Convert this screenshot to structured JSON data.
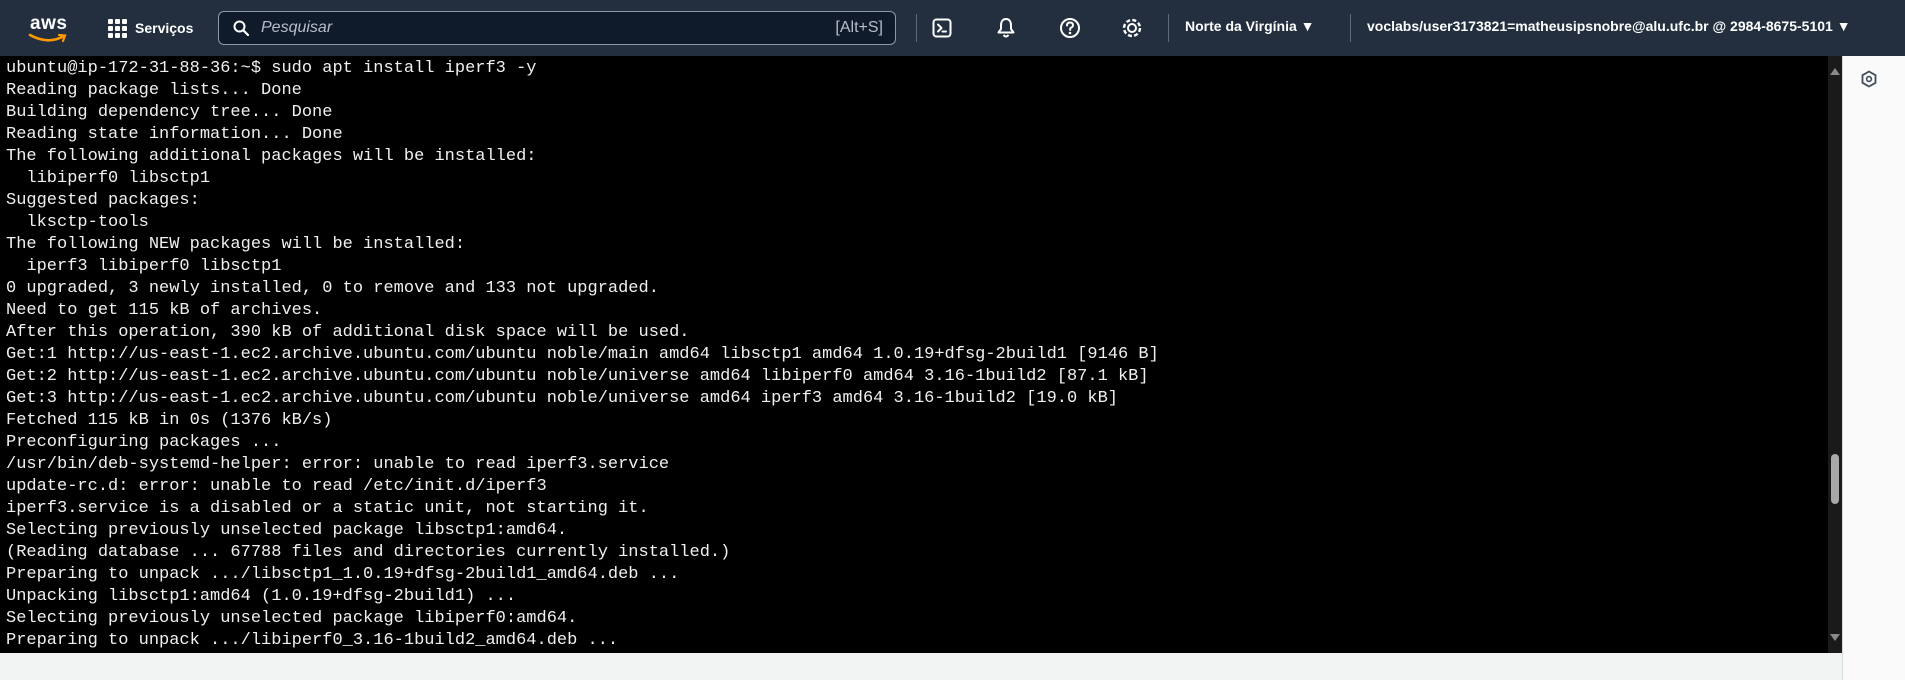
{
  "nav": {
    "logo_text": "aws",
    "services_label": "Serviços",
    "search_placeholder": "Pesquisar",
    "search_shortcut": "[Alt+S]",
    "region_label": "Norte da Virgínia ▼",
    "account_label": "voclabs/user3173821=matheusipsnobre@alu.ufc.br @ 2984-8675-5101 ▼",
    "icons": [
      "cloudshell-icon",
      "bell-icon",
      "help-icon",
      "settings-icon"
    ]
  },
  "terminal": {
    "lines": [
      "ubuntu@ip-172-31-88-36:~$ sudo apt install iperf3 -y",
      "Reading package lists... Done",
      "Building dependency tree... Done",
      "Reading state information... Done",
      "The following additional packages will be installed:",
      "  libiperf0 libsctp1",
      "Suggested packages:",
      "  lksctp-tools",
      "The following NEW packages will be installed:",
      "  iperf3 libiperf0 libsctp1",
      "0 upgraded, 3 newly installed, 0 to remove and 133 not upgraded.",
      "Need to get 115 kB of archives.",
      "After this operation, 390 kB of additional disk space will be used.",
      "Get:1 http://us-east-1.ec2.archive.ubuntu.com/ubuntu noble/main amd64 libsctp1 amd64 1.0.19+dfsg-2build1 [9146 B]",
      "Get:2 http://us-east-1.ec2.archive.ubuntu.com/ubuntu noble/universe amd64 libiperf0 amd64 3.16-1build2 [87.1 kB]",
      "Get:3 http://us-east-1.ec2.archive.ubuntu.com/ubuntu noble/universe amd64 iperf3 amd64 3.16-1build2 [19.0 kB]",
      "Fetched 115 kB in 0s (1376 kB/s)",
      "Preconfiguring packages ...",
      "/usr/bin/deb-systemd-helper: error: unable to read iperf3.service",
      "update-rc.d: error: unable to read /etc/init.d/iperf3",
      "iperf3.service is a disabled or a static unit, not starting it.",
      "Selecting previously unselected package libsctp1:amd64.",
      "(Reading database ... 67788 files and directories currently installed.)",
      "Preparing to unpack .../libsctp1_1.0.19+dfsg-2build1_amd64.deb ...",
      "Unpacking libsctp1:amd64 (1.0.19+dfsg-2build1) ...",
      "Selecting previously unselected package libiperf0:amd64.",
      "Preparing to unpack .../libiperf0_3.16-1build2_amd64.deb ..."
    ]
  },
  "scroll": {
    "position_fraction": 0.74
  },
  "colors": {
    "nav_bg": "#232f3e",
    "terminal_bg": "#000000",
    "terminal_fg": "#f0f0f0",
    "aws_smile": "#ff9900"
  }
}
